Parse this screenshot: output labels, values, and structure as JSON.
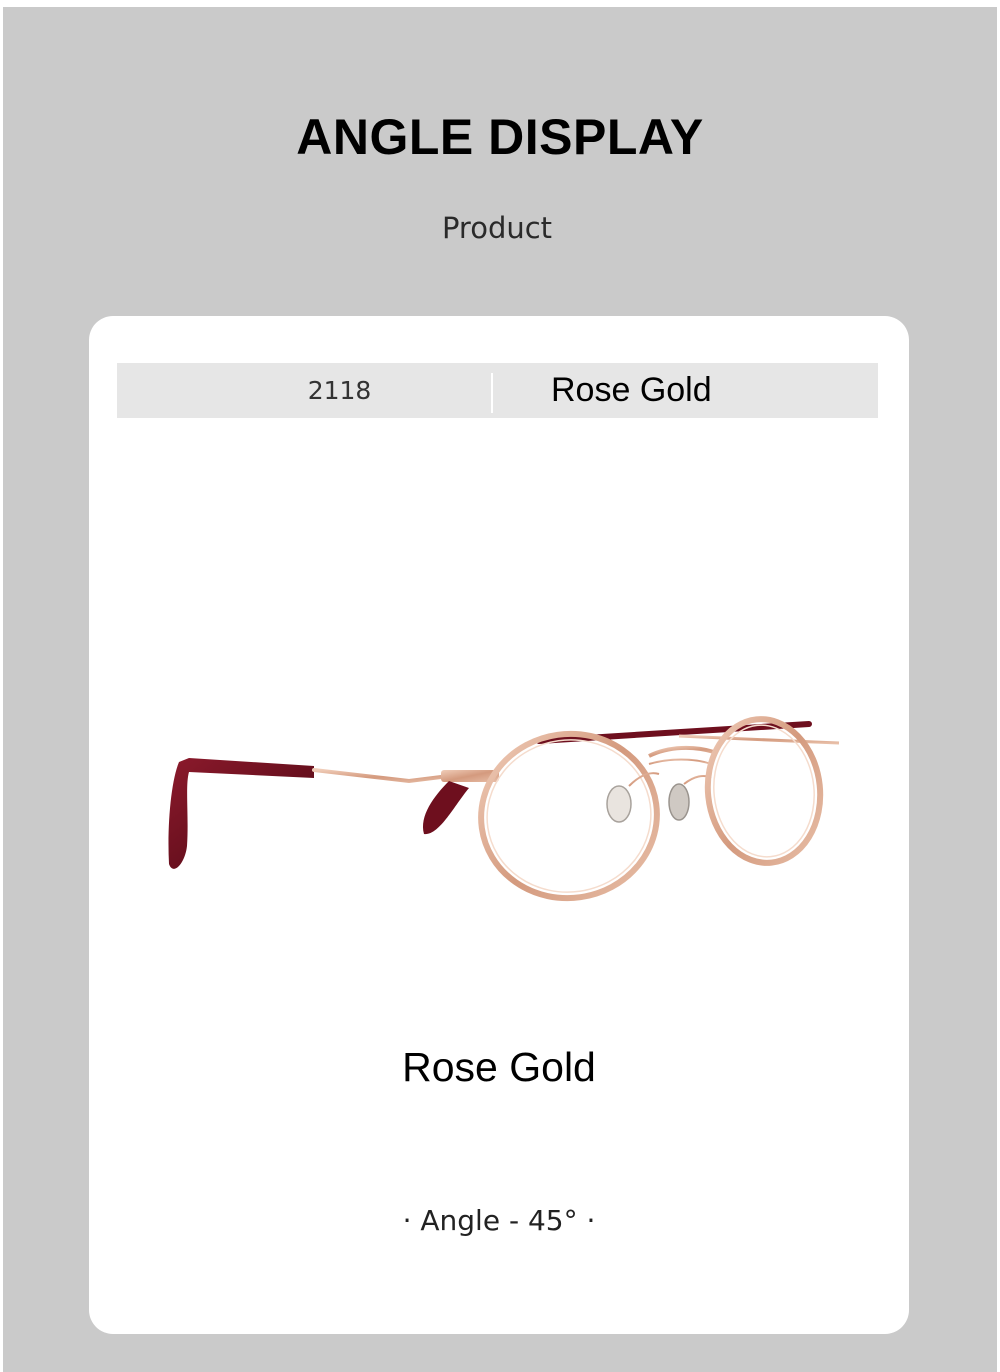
{
  "header": {
    "title": "ANGLE DISPLAY",
    "subtitle": "Product"
  },
  "card": {
    "model_number": "2118",
    "color_label": "Rose Gold",
    "image_icon": "eyeglasses-icon",
    "color_caption": "Rose Gold",
    "angle_caption": "· Angle - 45° ·"
  },
  "colors": {
    "page_background": "#cacaca",
    "card_background": "#ffffff",
    "info_bar_background": "#e6e6e6",
    "frame_rose_gold": "#d9a88f",
    "temple_tip_burgundy": "#6e0f1e"
  }
}
